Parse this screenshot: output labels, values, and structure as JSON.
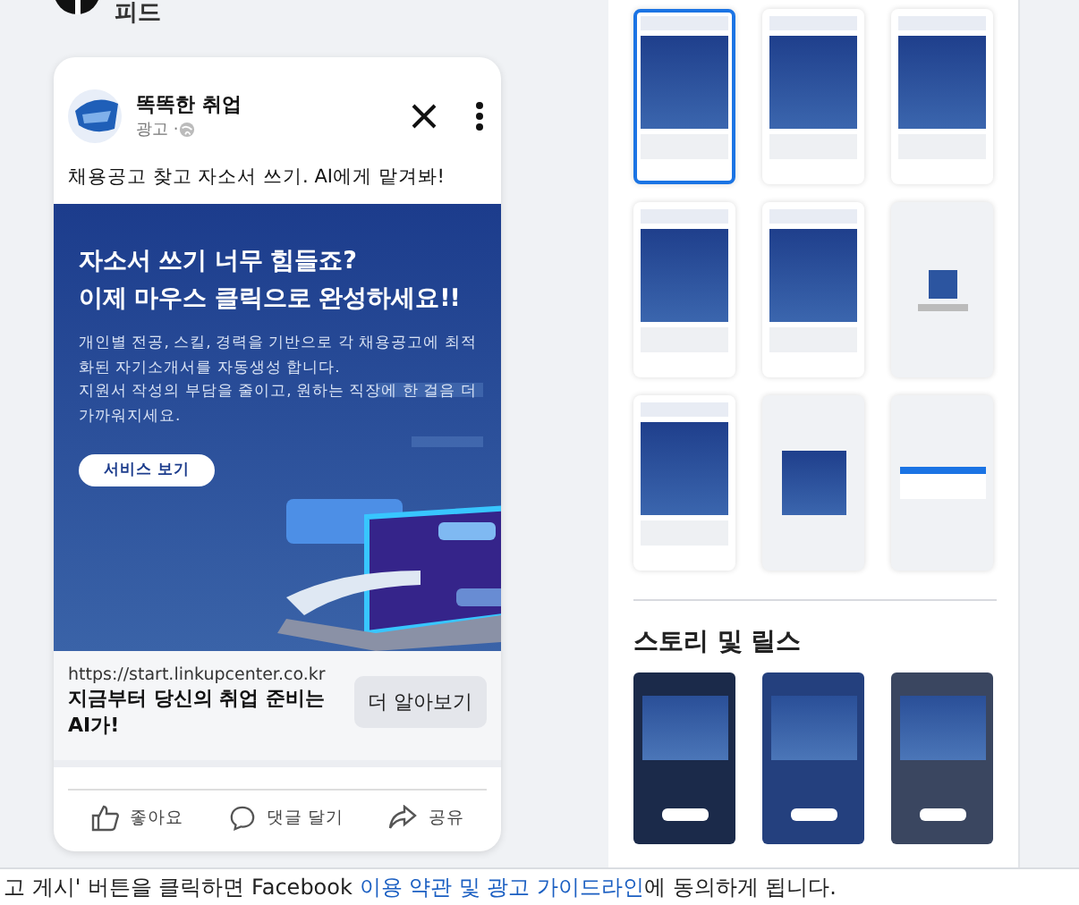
{
  "section_title": "피드",
  "ad_preview": {
    "page_name": "똑똑한 취업",
    "sponsored": "광고 · ",
    "caption": "채용공고 찾고 자소서 쓰기. AI에게 맡겨봐!",
    "creative": {
      "headline": [
        "자소서 쓰기 너무 힘들죠?",
        "이제 마우스 클릭으로 완성하세요!!"
      ],
      "body": "개인별 전공, 스킬, 경력을 기반으로 각 채용공고에 최적화된 자기소개서를 자동생성 합니다.\n지원서 작성의 부담을 줄이고, 원하는 직장에 한 걸음 더 가까워지세요.",
      "button": "서비스 보기"
    },
    "link_url": "https://start.linkupcenter.co.kr",
    "link_title": "지금부터 당신의 취업 준비는 AI가!",
    "cta": "더 알아보기",
    "actions": [
      {
        "kind": "like",
        "label": "좋아요"
      },
      {
        "kind": "comment",
        "label": "댓글 달기"
      },
      {
        "kind": "share",
        "label": "공유"
      }
    ]
  },
  "placements": [
    {
      "kind": "post",
      "selected": true
    },
    {
      "kind": "post",
      "selected": false
    },
    {
      "kind": "post",
      "selected": false
    },
    {
      "kind": "post",
      "selected": false
    },
    {
      "kind": "post",
      "selected": false
    },
    {
      "kind": "listing",
      "selected": false
    },
    {
      "kind": "post",
      "selected": false
    },
    {
      "kind": "inset",
      "selected": false
    },
    {
      "kind": "search",
      "selected": false
    }
  ],
  "stories_title": "스토리 및 릴스",
  "stories": [
    {
      "kind": "dark",
      "selected": false
    },
    {
      "kind": "blue",
      "selected": false
    },
    {
      "kind": "gray",
      "selected": false
    }
  ],
  "footer": {
    "before": "고 게시' 버튼을 클릭하면 Facebook ",
    "link": "이용 약관 및 광고 가이드라인",
    "after": "에 동의하게 됩니다."
  }
}
